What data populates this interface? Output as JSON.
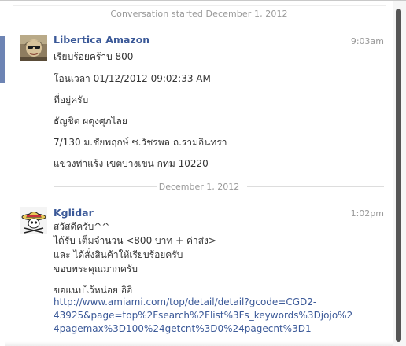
{
  "conversation": {
    "started_text": "Conversation started December 1, 2012",
    "date_divider": "December 1, 2012"
  },
  "messages": [
    {
      "sender": "Libertica Amazon",
      "time": "9:03am",
      "lines": [
        "เรียบร้อยคร้าบ 800",
        "โอนเวลา 01/12/2012 09:02:33 AM",
        "ที่อยู่ครับ",
        "ธัญชิต ผดุงศุภไลย",
        "7/130 ม.ชัยพฤกษ์ ซ.วัชรพล ถ.รามอินทรา",
        "แขวงท่าแร้ง เขตบางเขน กทม 10220"
      ]
    },
    {
      "sender": "Kglidar",
      "time": "1:02pm",
      "lines": [
        "สวัสดีครับ^^",
        "ได้รับ เต็มจำนวน <800 บาท + ค่าส่ง>",
        "และ ได้สั่งสินค้าให้เรียบร้อยครับ",
        "ขอบพระคุณมากครับ",
        "ขอแนบไว้หน่อย อิอิ"
      ],
      "link_lines": [
        "http://www.amiami.com/top/detail/detail?gcode=CGD2-",
        "43925&page=top%2Fsearch%2Flist%3Fs_keywords%3Djojo%2",
        "4pagemax%3D100%24getcnt%3D0%24pagecnt%3D1"
      ]
    }
  ],
  "icons": {
    "avatar_1": "profile-photo",
    "avatar_2": "straw-hat-skull-avatar"
  },
  "colors": {
    "sender_name": "#3b5998",
    "link": "#3b5998",
    "meta_text": "#999999",
    "scroll_thumb": "#555555",
    "left_accent": "#6d84b4"
  }
}
